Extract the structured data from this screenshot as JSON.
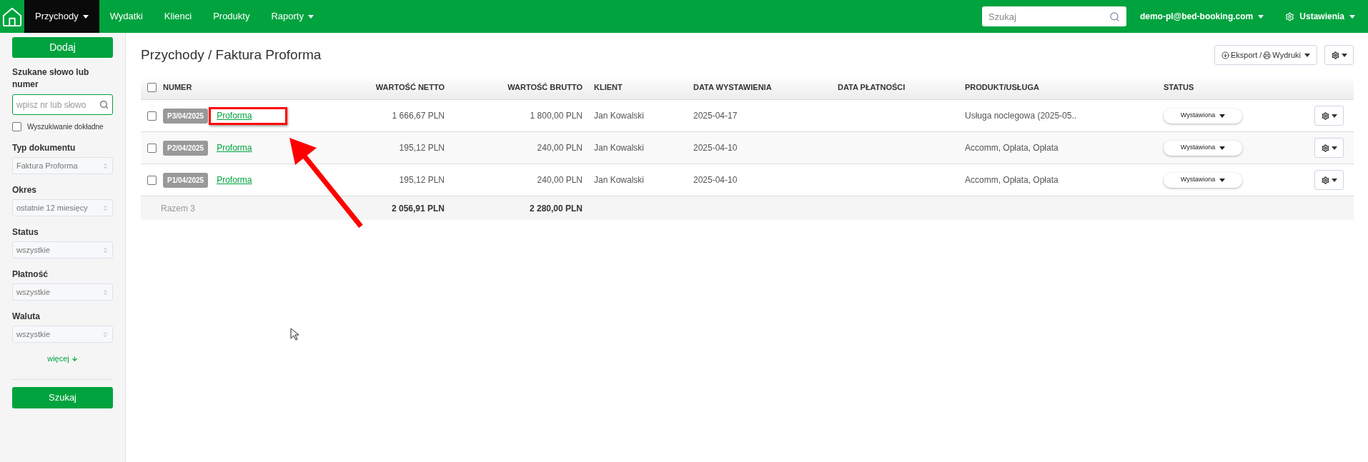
{
  "nav": {
    "items": [
      {
        "label": "Przychody",
        "selected": true,
        "dropdown": true
      },
      {
        "label": "Wydatki",
        "selected": false,
        "dropdown": false
      },
      {
        "label": "Klienci",
        "selected": false,
        "dropdown": false
      },
      {
        "label": "Produkty",
        "selected": false,
        "dropdown": false
      },
      {
        "label": "Raporty",
        "selected": false,
        "dropdown": true
      }
    ],
    "search": {
      "placeholder": "Szukaj"
    },
    "account": "demo-pl@bed-booking.com",
    "settings": "Ustawienia"
  },
  "sidebar": {
    "add_button": "Dodaj",
    "search_label": "Szukane słowo lub numer",
    "search_placeholder": "wpisz nr lub słowo",
    "exact": {
      "label": "Wyszukiwanie dokładne",
      "checked": false
    },
    "filters": [
      {
        "label": "Typ dokumentu",
        "value": "Faktura Proforma"
      },
      {
        "label": "Okres",
        "value": "ostatnie 12 miesięcy"
      },
      {
        "label": "Status",
        "value": "wszystkie"
      },
      {
        "label": "Płatność",
        "value": "wszystkie"
      },
      {
        "label": "Waluta",
        "value": "wszystkie"
      }
    ],
    "more": "więcej",
    "search_button": "Szukaj"
  },
  "page": {
    "title": "Przychody / Faktura Proforma",
    "export_button": "Eksport / ",
    "print_label": "Wydruki"
  },
  "table": {
    "columns": [
      "NUMER",
      "WARTOŚĆ NETTO",
      "WARTOŚĆ BRUTTO",
      "KLIENT",
      "DATA WYSTAWIENIA",
      "DATA PŁATNOŚCI",
      "PRODUKT/USŁUGA",
      "STATUS"
    ],
    "all_checked": false,
    "rows": [
      {
        "checked": false,
        "highlighted": true,
        "number": "P3/04/2025",
        "type": "Proforma",
        "net": "1 666,67 PLN",
        "gross": "1 800,00 PLN",
        "client": "Jan Kowalski",
        "issue_date": "2025-04-17",
        "product": "Usługa noclegowa (2025-05..",
        "status": "Wystawiona"
      },
      {
        "checked": false,
        "highlighted": false,
        "number": "P2/04/2025",
        "type": "Proforma",
        "net": "195,12 PLN",
        "gross": "240,00 PLN",
        "client": "Jan Kowalski",
        "issue_date": "2025-04-10",
        "product": "Accomm, Opłata, Opłata",
        "status": "Wystawiona"
      },
      {
        "checked": false,
        "highlighted": false,
        "number": "P1/04/2025",
        "type": "Proforma",
        "net": "195,12 PLN",
        "gross": "240,00 PLN",
        "client": "Jan Kowalski",
        "issue_date": "2025-04-10",
        "product": "Accomm, Opłata, Opłata",
        "status": "Wystawiona"
      }
    ],
    "total": {
      "label": "Razem 3",
      "net": "2 056,91 PLN",
      "gross": "2 280,00 PLN"
    }
  }
}
